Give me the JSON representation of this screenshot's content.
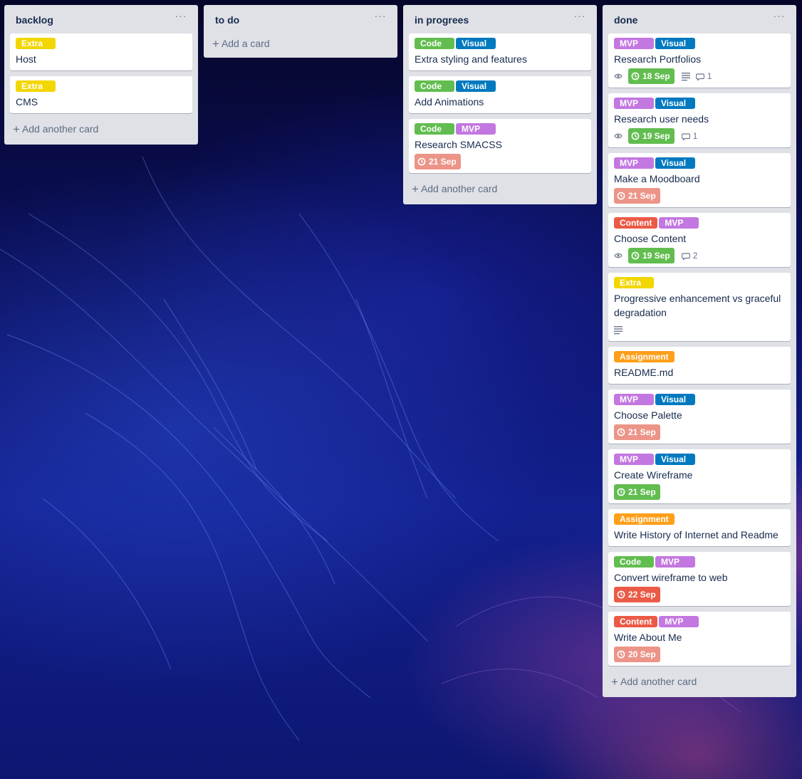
{
  "colors": {
    "extra": "#f2d600",
    "code": "#61bd4f",
    "visual": "#0079bf",
    "mvp": "#c377e0",
    "content": "#eb5a46",
    "assignment": "#ff9f1a",
    "due_complete": "#61bd4f",
    "due_past": "#ec9488",
    "due_overdue": "#eb5a46"
  },
  "lists": [
    {
      "title": "backlog",
      "menu": "···",
      "add_label": "Add another card",
      "cards": [
        {
          "labels": [
            {
              "text": "Extra",
              "color": "extra"
            }
          ],
          "title": "Host",
          "badges": null
        },
        {
          "labels": [
            {
              "text": "Extra",
              "color": "extra"
            }
          ],
          "title": "CMS",
          "badges": null
        }
      ]
    },
    {
      "title": "to do",
      "menu": "···",
      "add_label": "Add a card",
      "cards": []
    },
    {
      "title": "in progrees",
      "menu": "···",
      "add_label": "Add another card",
      "cards": [
        {
          "labels": [
            {
              "text": "Code",
              "color": "code"
            },
            {
              "text": "Visual",
              "color": "visual"
            }
          ],
          "title": "Extra styling and features",
          "badges": null
        },
        {
          "labels": [
            {
              "text": "Code",
              "color": "code"
            },
            {
              "text": "Visual",
              "color": "visual"
            }
          ],
          "title": "Add Animations",
          "badges": null
        },
        {
          "labels": [
            {
              "text": "Code",
              "color": "code"
            },
            {
              "text": "MVP",
              "color": "mvp"
            }
          ],
          "title": "Research SMACSS",
          "badges": {
            "due": "21 Sep",
            "due_state": "due_past"
          }
        }
      ]
    },
    {
      "title": "done",
      "menu": "···",
      "add_label": "Add another card",
      "cards": [
        {
          "labels": [
            {
              "text": "MVP",
              "color": "mvp"
            },
            {
              "text": "Visual",
              "color": "visual"
            }
          ],
          "title": "Research Portfolios",
          "badges": {
            "watch": true,
            "due": "18 Sep",
            "due_state": "due_complete",
            "description": true,
            "comments": "1"
          }
        },
        {
          "labels": [
            {
              "text": "MVP",
              "color": "mvp"
            },
            {
              "text": "Visual",
              "color": "visual"
            }
          ],
          "title": "Research user needs",
          "badges": {
            "watch": true,
            "due": "19 Sep",
            "due_state": "due_complete",
            "comments": "1"
          }
        },
        {
          "labels": [
            {
              "text": "MVP",
              "color": "mvp"
            },
            {
              "text": "Visual",
              "color": "visual"
            }
          ],
          "title": "Make a Moodboard",
          "badges": {
            "due": "21 Sep",
            "due_state": "due_past"
          }
        },
        {
          "labels": [
            {
              "text": "Content",
              "color": "content"
            },
            {
              "text": "MVP",
              "color": "mvp"
            }
          ],
          "title": "Choose Content",
          "badges": {
            "watch": true,
            "due": "19 Sep",
            "due_state": "due_complete",
            "comments": "2"
          }
        },
        {
          "labels": [
            {
              "text": "Extra",
              "color": "extra"
            }
          ],
          "title": "Progressive enhancement vs graceful degradation",
          "badges": {
            "description": true
          }
        },
        {
          "labels": [
            {
              "text": "Assignment",
              "color": "assignment"
            }
          ],
          "title": "README.md",
          "badges": null
        },
        {
          "labels": [
            {
              "text": "MVP",
              "color": "mvp"
            },
            {
              "text": "Visual",
              "color": "visual"
            }
          ],
          "title": "Choose Palette",
          "badges": {
            "due": "21 Sep",
            "due_state": "due_past"
          }
        },
        {
          "labels": [
            {
              "text": "MVP",
              "color": "mvp"
            },
            {
              "text": "Visual",
              "color": "visual"
            }
          ],
          "title": "Create Wireframe",
          "badges": {
            "due": "21 Sep",
            "due_state": "due_complete"
          }
        },
        {
          "labels": [
            {
              "text": "Assignment",
              "color": "assignment"
            }
          ],
          "title": "Write History of Internet and Readme",
          "badges": null
        },
        {
          "labels": [
            {
              "text": "Code",
              "color": "code"
            },
            {
              "text": "MVP",
              "color": "mvp"
            }
          ],
          "title": "Convert wireframe to web",
          "badges": {
            "due": "22 Sep",
            "due_state": "due_overdue"
          }
        },
        {
          "labels": [
            {
              "text": "Content",
              "color": "content"
            },
            {
              "text": "MVP",
              "color": "mvp"
            }
          ],
          "title": "Write About Me",
          "badges": {
            "due": "20 Sep",
            "due_state": "due_past"
          }
        }
      ]
    }
  ]
}
